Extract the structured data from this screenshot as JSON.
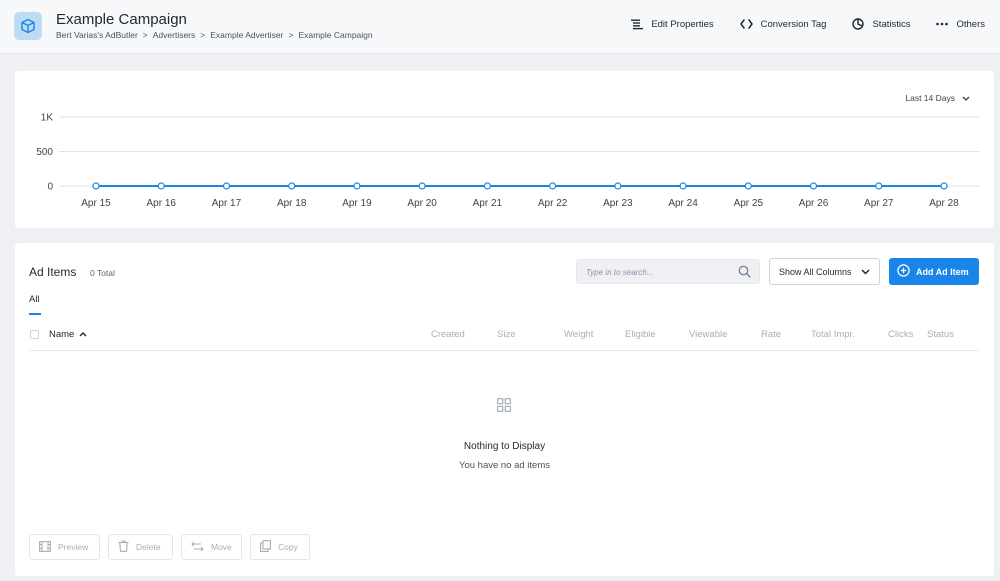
{
  "header": {
    "title": "Example Campaign",
    "breadcrumb": [
      "Bert Varias's AdButler",
      "Advertisers",
      "Example Advertiser",
      "Example Campaign"
    ],
    "breadcrumb_sep": ">",
    "actions": {
      "edit_properties": "Edit Properties",
      "conversion_tag": "Conversion Tag",
      "statistics": "Statistics",
      "others": "Others"
    }
  },
  "chart_controls": {
    "range_label": "Last 14 Days"
  },
  "chart_data": {
    "type": "line",
    "categories": [
      "Apr 15",
      "Apr 16",
      "Apr 17",
      "Apr 18",
      "Apr 19",
      "Apr 20",
      "Apr 21",
      "Apr 22",
      "Apr 23",
      "Apr 24",
      "Apr 25",
      "Apr 26",
      "Apr 27",
      "Apr 28"
    ],
    "values": [
      0,
      0,
      0,
      0,
      0,
      0,
      0,
      0,
      0,
      0,
      0,
      0,
      0,
      0
    ],
    "yticks": [
      0,
      500,
      1000
    ],
    "ytick_labels": [
      "0",
      "500",
      "1K"
    ],
    "ylim": [
      0,
      1000
    ],
    "grid": true,
    "series_color": "#1a85e8"
  },
  "ad_items": {
    "title": "Ad Items",
    "count_label": "0 Total",
    "search_placeholder": "Type in to search...",
    "columns_button": "Show All Columns",
    "add_button": "Add Ad Item",
    "tab_all": "All",
    "columns": {
      "name": "Name",
      "created": "Created",
      "size": "Size",
      "weight": "Weight",
      "eligible": "Eligible",
      "viewable": "Viewable",
      "rate": "Rate",
      "total_impr": "Total Impr.",
      "clicks": "Clicks",
      "status": "Status"
    },
    "empty_title": "Nothing to Display",
    "empty_subtitle": "You have no ad items",
    "bulk": {
      "preview": "Preview",
      "delete": "Delete",
      "move": "Move",
      "copy": "Copy"
    }
  },
  "colors": {
    "accent": "#1a85e8",
    "icon_bg": "#bcdcf5"
  }
}
